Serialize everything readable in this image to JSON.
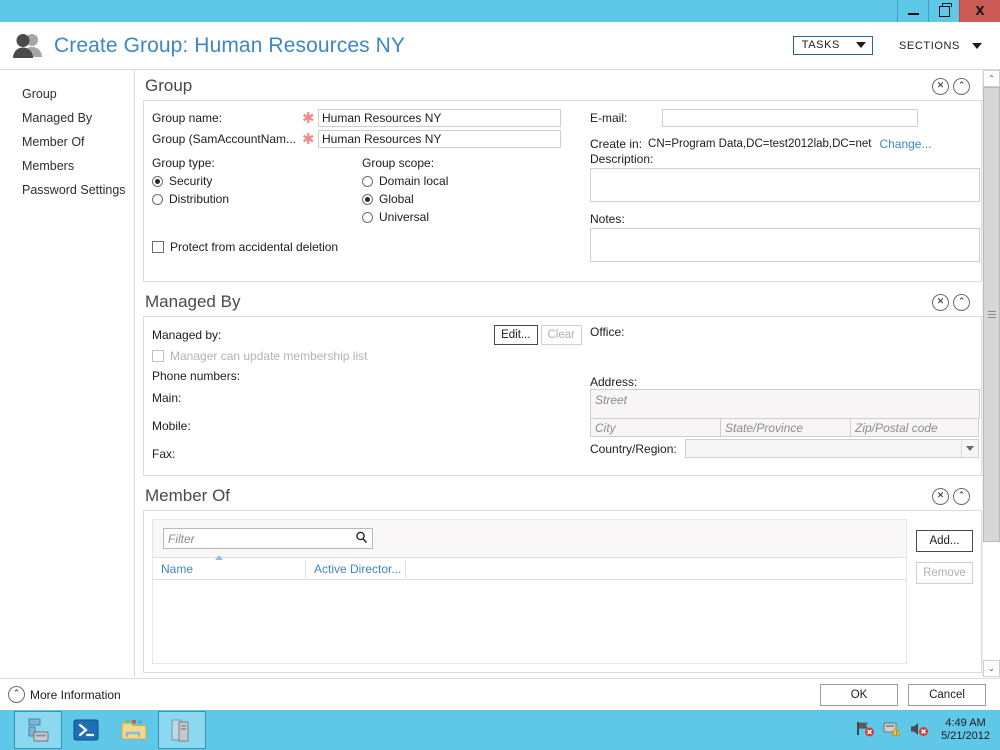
{
  "window": {
    "minimize_label": "minimize",
    "maximize_label": "restore",
    "close_label": "X"
  },
  "header": {
    "title": "Create Group: Human Resources NY",
    "tasks_label": "TASKS",
    "sections_label": "SECTIONS"
  },
  "sidebar": {
    "items": [
      {
        "label": "Group"
      },
      {
        "label": "Managed By"
      },
      {
        "label": "Member Of"
      },
      {
        "label": "Members"
      },
      {
        "label": "Password Settings"
      }
    ]
  },
  "group_section": {
    "title": "Group",
    "group_name_label": "Group name:",
    "group_name_value": "Human Resources NY",
    "sam_label": "Group (SamAccountNam...",
    "sam_value": "Human Resources NY",
    "required_marker": "✱",
    "group_type_label": "Group type:",
    "group_type_options": [
      {
        "label": "Security",
        "selected": true
      },
      {
        "label": "Distribution",
        "selected": false
      }
    ],
    "group_scope_label": "Group scope:",
    "group_scope_options": [
      {
        "label": "Domain local",
        "selected": false
      },
      {
        "label": "Global",
        "selected": true
      },
      {
        "label": "Universal",
        "selected": false
      }
    ],
    "protect_label": "Protect from accidental deletion",
    "protect_checked": false,
    "email_label": "E-mail:",
    "email_value": "",
    "create_in_label": "Create in:",
    "create_in_value": "CN=Program Data,DC=test2012lab,DC=net",
    "change_link": "Change...",
    "description_label": "Description:",
    "description_value": "",
    "notes_label": "Notes:",
    "notes_value": ""
  },
  "managed_by_section": {
    "title": "Managed By",
    "managed_by_label": "Managed by:",
    "edit_button": "Edit...",
    "clear_button": "Clear",
    "manager_update_label": "Manager can update membership list",
    "phone_numbers_label": "Phone numbers:",
    "main_label": "Main:",
    "mobile_label": "Mobile:",
    "fax_label": "Fax:",
    "office_label": "Office:",
    "address_label": "Address:",
    "street_placeholder": "Street",
    "city_placeholder": "City",
    "state_placeholder": "State/Province",
    "zip_placeholder": "Zip/Postal code",
    "country_label": "Country/Region:",
    "country_value": ""
  },
  "member_of_section": {
    "title": "Member Of",
    "filter_placeholder": "Filter",
    "columns": [
      "Name",
      "Active Director..."
    ],
    "rows": [],
    "add_button": "Add...",
    "remove_button": "Remove"
  },
  "footer": {
    "more_information": "More Information",
    "ok_label": "OK",
    "cancel_label": "Cancel"
  },
  "taskbar": {
    "items": [
      {
        "name": "server-manager",
        "active": true
      },
      {
        "name": "powershell",
        "active": false
      },
      {
        "name": "file-explorer",
        "active": false
      },
      {
        "name": "ad-admin-center",
        "active": true
      }
    ],
    "tray": [
      {
        "name": "network-error-icon"
      },
      {
        "name": "action-center-warning-icon"
      },
      {
        "name": "volume-muted-icon"
      }
    ],
    "time": "4:49 AM",
    "date": "5/21/2012"
  },
  "colors": {
    "accent": "#5fc8e8",
    "link": "#3f86c4",
    "close": "#cc5a55",
    "required": "#f08a8a"
  }
}
